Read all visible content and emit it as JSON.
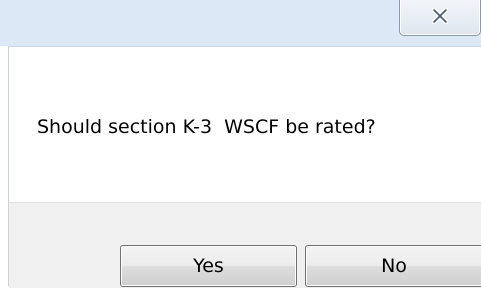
{
  "dialog": {
    "message": "Should section K-3  WSCF be rated?",
    "buttons": {
      "yes_label": "Yes",
      "no_label": "No"
    }
  },
  "titlebar": {
    "close_icon": "close-icon"
  }
}
